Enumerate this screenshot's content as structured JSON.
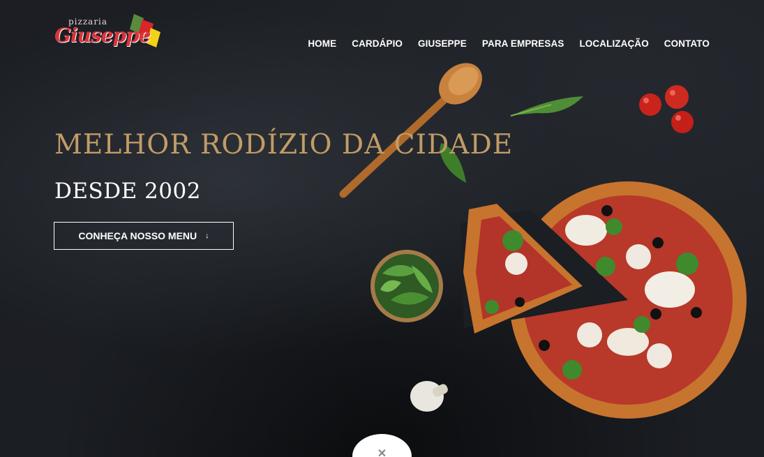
{
  "logo": {
    "small_text": "pizzaria",
    "main_text": "Giuseppe"
  },
  "nav": [
    {
      "label": "HOME"
    },
    {
      "label": "CARDÁPIO"
    },
    {
      "label": "GIUSEPPE"
    },
    {
      "label": "PARA EMPRESAS"
    },
    {
      "label": "LOCALIZAÇÃO"
    },
    {
      "label": "CONTATO"
    }
  ],
  "hero": {
    "headline": "MELHOR RODÍZIO DA CIDADE",
    "subheadline": "DESDE 2002",
    "cta_label": "CONHEÇA NOSSO MENU",
    "cta_icon": "double-chevron-down-icon"
  },
  "scroll_icon": "close-icon",
  "colors": {
    "headline": "#c19c66",
    "background": "#1b1e23",
    "logo_red": "#d8353b"
  }
}
